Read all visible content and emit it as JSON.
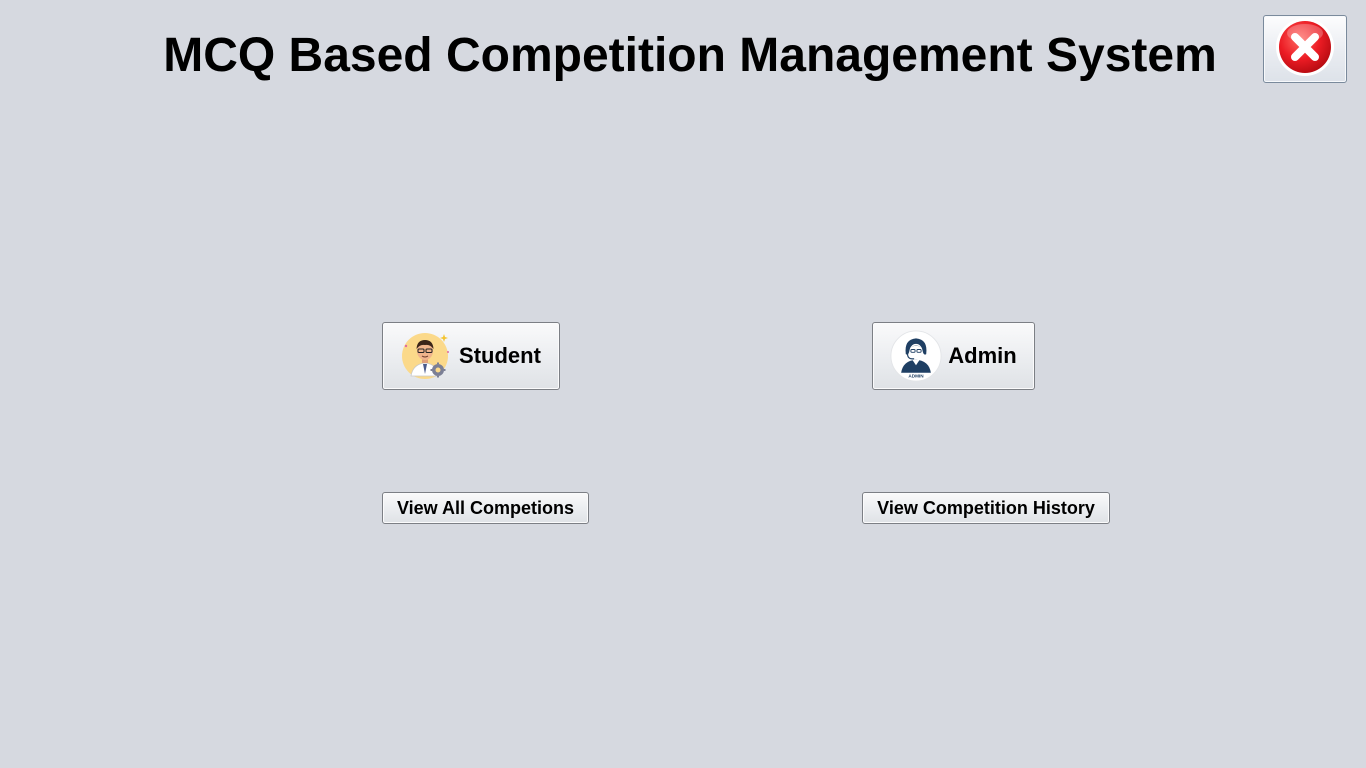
{
  "app": {
    "title": "MCQ Based Competition Management System"
  },
  "close_button": {
    "icon": "close-icon",
    "color": "#e8141b"
  },
  "buttons": {
    "student": {
      "label": "Student",
      "icon": "student-avatar-icon"
    },
    "admin": {
      "label": "Admin",
      "icon": "admin-avatar-icon",
      "icon_text": "ADMIN"
    },
    "view_all": {
      "label": "View All Competions"
    },
    "history": {
      "label": "View Competition History"
    }
  },
  "colors": {
    "background": "#d6d9e0",
    "admin_accent": "#1f3f63"
  }
}
